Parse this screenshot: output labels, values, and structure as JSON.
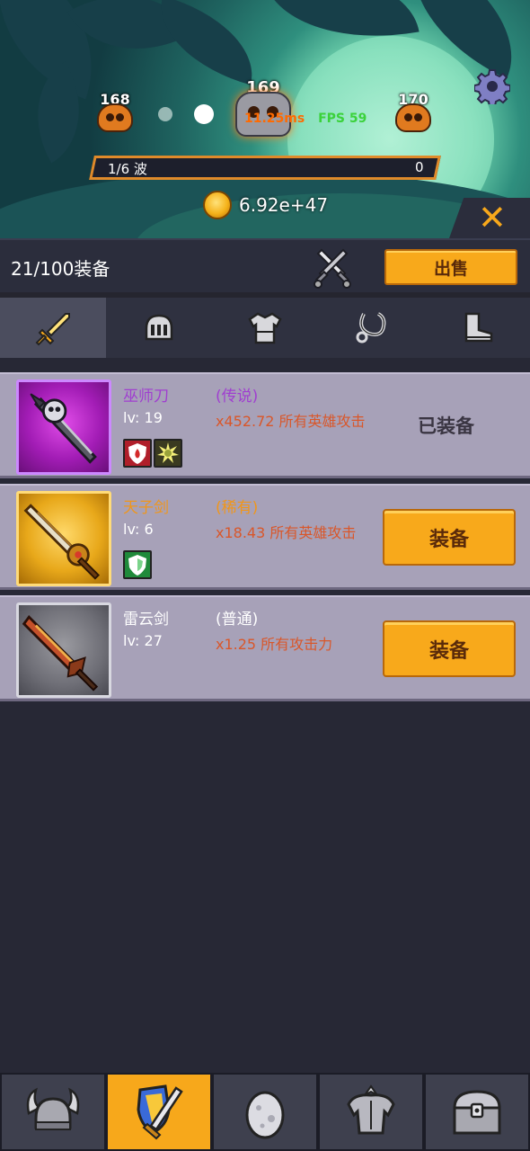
{
  "battle": {
    "prev_level": "168",
    "current_level": "169",
    "next_level": "170",
    "debug_ms": "11.25ms",
    "fps": "FPS 59",
    "wave_label": "1/6 波",
    "wave_value": "0",
    "gold": "6.92e+47"
  },
  "header": {
    "equipment_count": "21/100装备",
    "sell_label": "出售"
  },
  "tabs": [
    {
      "name": "weapon",
      "icon": "sword-icon",
      "active": true
    },
    {
      "name": "helmet",
      "icon": "helmet-icon",
      "active": false
    },
    {
      "name": "armor",
      "icon": "armor-icon",
      "active": false
    },
    {
      "name": "necklace",
      "icon": "necklace-icon",
      "active": false
    },
    {
      "name": "boots",
      "icon": "boots-icon",
      "active": false
    }
  ],
  "items": [
    {
      "name": "巫师刀",
      "rarity": "(传说)",
      "level": "lv: 19",
      "bonus": "x452.72 所有英雄攻击",
      "status": "已装备",
      "name_color": "#a03ed0",
      "badges": [
        "fire-shield-icon",
        "star-burst-icon"
      ]
    },
    {
      "name": "天子剑",
      "rarity": "(稀有)",
      "level": "lv: 6",
      "bonus": "x18.43 所有英雄攻击",
      "button": "装备",
      "name_color": "#f0961a",
      "badges": [
        "green-shield-icon"
      ]
    },
    {
      "name": "雷云剑",
      "rarity": "(普通)",
      "level": "lv: 27",
      "bonus": "x1.25 所有攻击力",
      "button": "装备",
      "name_color": "#ffffff",
      "badges": []
    }
  ],
  "bottom_nav": [
    {
      "icon": "viking-helmet-icon",
      "active": false
    },
    {
      "icon": "shield-sword-icon",
      "active": true
    },
    {
      "icon": "egg-icon",
      "active": false
    },
    {
      "icon": "knight-armor-icon",
      "active": false
    },
    {
      "icon": "treasure-chest-icon",
      "active": false
    }
  ],
  "colors": {
    "accent": "#f8a91b",
    "legend": "#a03ed0",
    "rare": "#f0961a",
    "bonus": "#d9572a"
  }
}
